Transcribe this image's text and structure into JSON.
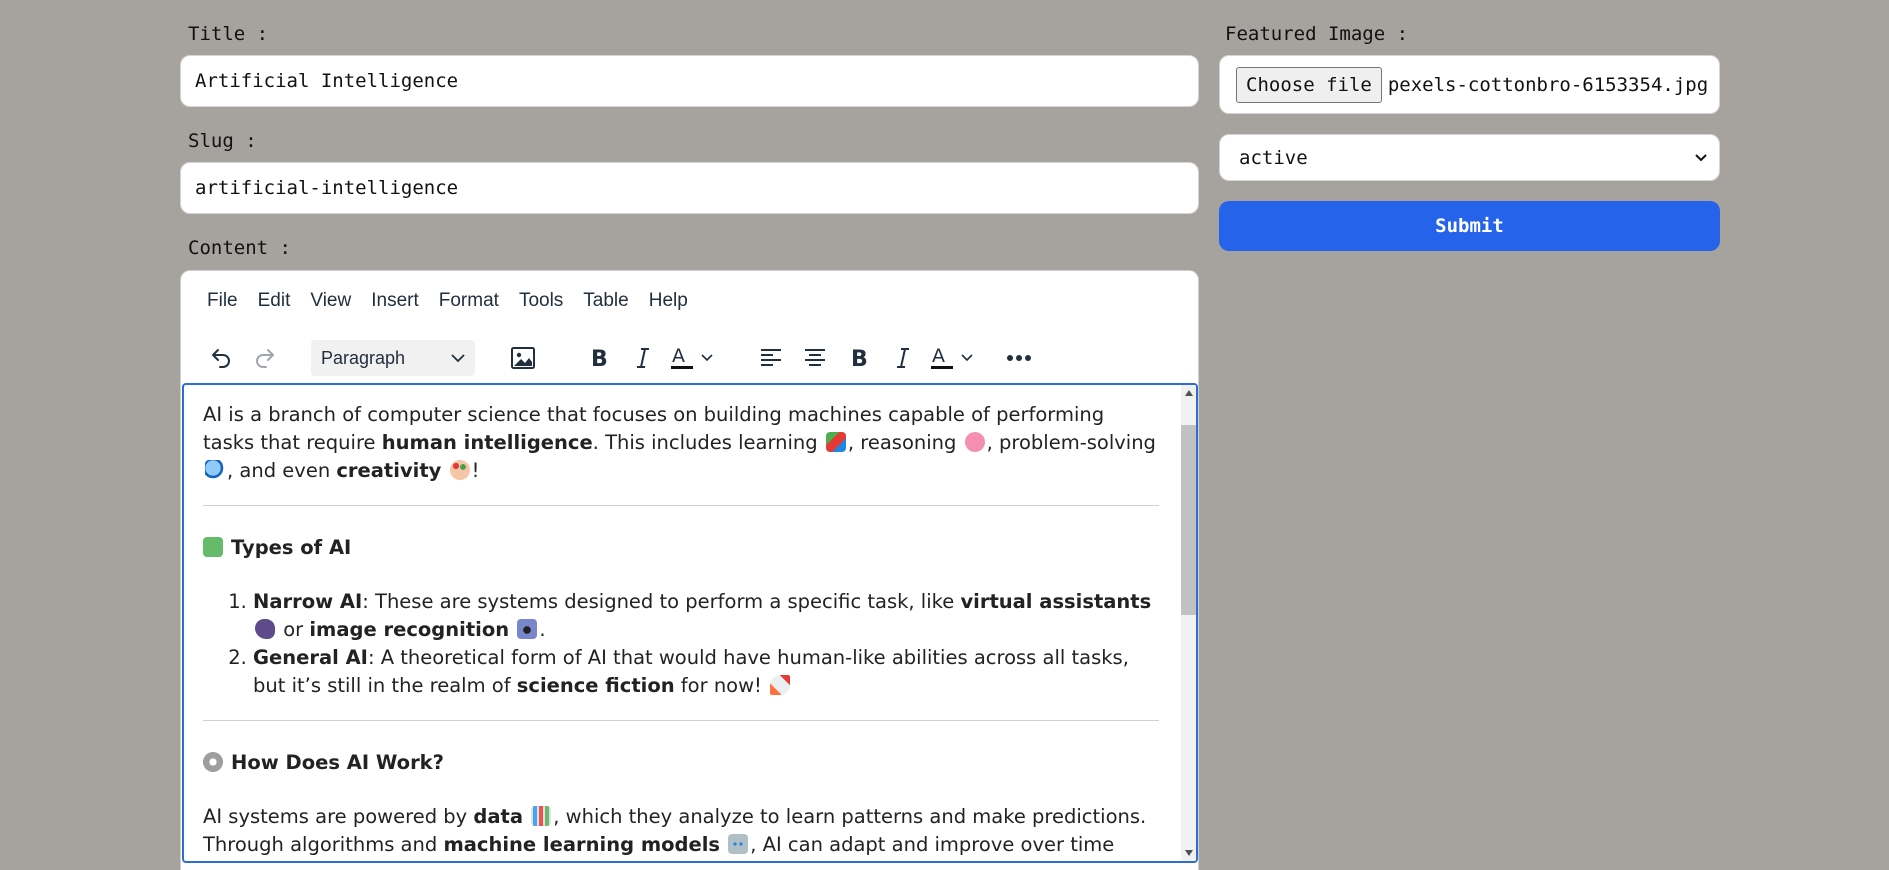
{
  "form": {
    "title_label": "Title :",
    "title_value": "Artificial Intelligence",
    "slug_label": "Slug :",
    "slug_value": "artificial-intelligence",
    "content_label": "Content :",
    "featured_label": "Featured Image :",
    "choose_file_label": "Choose file",
    "file_name": "pexels-cottonbro-6153354.jpg",
    "status_value": "active",
    "submit_label": "Submit"
  },
  "editor": {
    "menu": [
      "File",
      "Edit",
      "View",
      "Insert",
      "Format",
      "Tools",
      "Table",
      "Help"
    ],
    "toolbar": {
      "format_select": "Paragraph",
      "icons": [
        "undo-icon",
        "redo-icon",
        "image-icon",
        "bold-icon",
        "italic-icon",
        "text-color-icon",
        "align-left-icon",
        "align-center-icon",
        "bold-icon",
        "italic-icon",
        "text-color-icon",
        "more-icon"
      ]
    },
    "content": {
      "intro": {
        "t1": "AI is a branch of computer science that focuses on building machines capable of performing tasks that require ",
        "b1": "human intelligence",
        "t2": ". This includes learning ",
        "t3": ", reasoning ",
        "t4": ", problem-solving ",
        "t5": ", and even ",
        "b2": "creativity",
        "t6": "!"
      },
      "types_heading": "Types of AI",
      "types": [
        {
          "name": "Narrow AI",
          "t1": ": These are systems designed to perform a specific task, like ",
          "b1": "virtual assistants",
          "t2": " or ",
          "b2": "image recognition",
          "t3": "."
        },
        {
          "name": "General AI",
          "t1": ": A theoretical form of AI that would have human-like abilities across all tasks, but it’s still in the realm of ",
          "b1": "science fiction",
          "t2": " for now! "
        }
      ],
      "how_heading": "How Does AI Work?",
      "how": {
        "t1": "AI systems are powered by ",
        "b1": "data",
        "t2": ", which they analyze to learn patterns and make predictions. Through algorithms and ",
        "b2": "machine learning models",
        "t3": ", AI can adapt and improve over time without explicit"
      }
    }
  },
  "colors": {
    "page_bg": "#a6a29e",
    "submit_bg": "#2563eb",
    "editor_focus": "#2b6fd6"
  }
}
